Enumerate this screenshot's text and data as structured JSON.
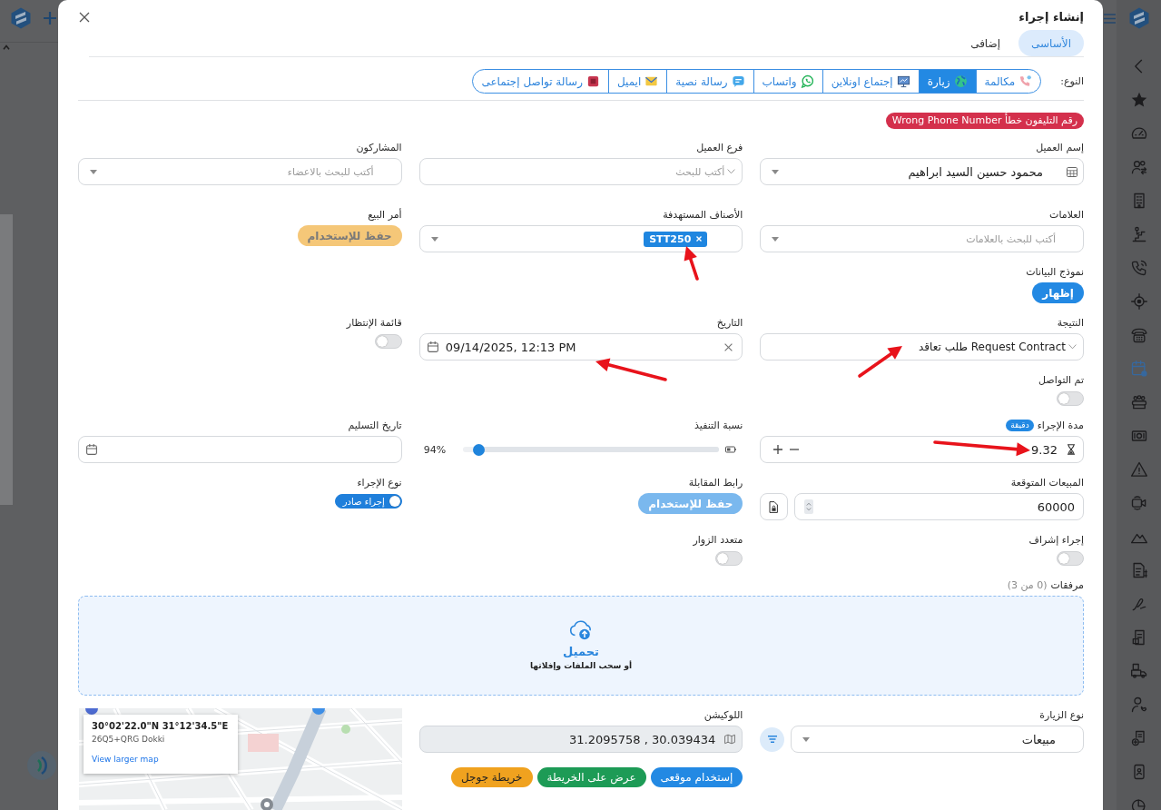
{
  "app_sidebar": {
    "items": [
      {
        "selected": false
      },
      {
        "selected": false
      },
      {
        "selected": false
      },
      {
        "selected": false
      },
      {
        "selected": false
      },
      {
        "selected": false
      },
      {
        "selected": false
      },
      {
        "selected": false
      },
      {
        "selected": true
      },
      {
        "selected": false
      },
      {
        "selected": false
      },
      {
        "selected": false
      },
      {
        "selected": false
      },
      {
        "selected": false
      },
      {
        "selected": false
      },
      {
        "selected": false
      },
      {
        "selected": false
      },
      {
        "selected": false
      },
      {
        "selected": false
      },
      {
        "selected": false
      },
      {
        "selected": false
      },
      {
        "selected": false
      }
    ]
  },
  "dialog": {
    "title": "إنشاء إجراء",
    "tabs": [
      {
        "label": "الأساسى",
        "selected": true
      },
      {
        "label": "إضافى",
        "selected": false
      }
    ],
    "type_selector": {
      "label": "النوع:",
      "options": [
        {
          "label": "مكالمة",
          "selected": false
        },
        {
          "label": "زيارة",
          "selected": true
        },
        {
          "label": "إجتماع اونلاين",
          "selected": false
        },
        {
          "label": "واتساب",
          "selected": false
        },
        {
          "label": "رسالة نصية",
          "selected": false
        },
        {
          "label": "ايميل",
          "selected": false
        },
        {
          "label": "رسالة تواصل إجتماعى",
          "selected": false
        }
      ]
    },
    "alert_badge": "Wrong Phone Number رقم التليفون خطأ",
    "rows": [
      [
        {
          "kind": "lookup",
          "label": "إسم العميل",
          "value": "محمود حسين السيد ابراهيم"
        },
        {
          "kind": "combo",
          "label": "فرع العميل",
          "placeholder": "أكتب للبحث"
        },
        {
          "kind": "select",
          "label": "المشاركون",
          "placeholder": "أكتب للبحث بالاعضاء"
        }
      ],
      [
        {
          "kind": "select",
          "label": "العلامات",
          "placeholder": "أكتب للبحث بالعلامات"
        },
        {
          "kind": "tags",
          "label": "الأصناف المستهدفة",
          "tags": [
            {
              "label": "STT250"
            }
          ],
          "annotation_arrow": true
        },
        {
          "kind": "action",
          "label": "أمر البيع",
          "button": {
            "label": "حفظ للإستخدام",
            "kind": "warning",
            "disabled": true
          }
        }
      ],
      [
        {
          "kind": "action",
          "label": "نموذج البيانات",
          "button": {
            "label": "إظهار",
            "kind": "primary",
            "disabled": false
          }
        }
      ],
      [
        {
          "kind": "combo",
          "label": "النتيجة",
          "value": "Request Contract طلب تعاقد",
          "annotation_arrow": true
        },
        {
          "kind": "date",
          "label": "التاريخ",
          "value": "09/14/2025, 12:13 PM",
          "annotation_arrow": true
        },
        {
          "kind": "toggle",
          "label": "قائمة الإنتظار",
          "on": false
        }
      ],
      [
        {
          "kind": "toggle",
          "label": "تم التواصل",
          "on": false
        }
      ],
      [
        {
          "kind": "duration",
          "label": "مدة الإجراء",
          "unit": "دقيقة",
          "value": "9.32",
          "annotation_arrow": true
        },
        {
          "kind": "slider",
          "label": "نسبة التنفيذ",
          "level": 0.94,
          "reading": "94%"
        },
        {
          "kind": "date",
          "label": "تاريخ التسليم"
        }
      ],
      [
        {
          "kind": "number",
          "label": "المبيعات المتوقعة",
          "value": "60000"
        },
        {
          "kind": "action",
          "label": "رابط المقابلة",
          "button": {
            "label": "حفظ للإستخدام",
            "kind": "primary",
            "disabled": true
          }
        },
        {
          "kind": "toggle",
          "label": "نوع الإجراء",
          "on": true,
          "text": "إجراء صادر"
        }
      ],
      [
        {
          "kind": "toggle",
          "label": "إجراء إشراف",
          "on": false
        },
        {
          "kind": "toggle",
          "label": "متعدد الزوار",
          "on": false
        }
      ]
    ],
    "attachments": {
      "label": "مرفقات",
      "count": "(0 من 3)",
      "upload": "تحميل",
      "hint": "أو سحب الملفات وإفلاتها"
    },
    "bottom_row": [
      {
        "kind": "picker",
        "label": "نوع الزيارة",
        "value": "مبيعات"
      },
      {
        "kind": "location",
        "label": "اللوكيشن",
        "value": "31.2095758 , 30.039434",
        "disabled": true,
        "buttons": [
          {
            "label": "إستخدام موقعى",
            "kind": "primary",
            "disabled": false
          },
          {
            "label": "عرض على الخريطة",
            "kind": "success",
            "disabled": false
          },
          {
            "label": "خريطة جوجل",
            "kind": "warning",
            "disabled": false
          }
        ]
      },
      {
        "kind": "map",
        "coordinates": "30°02'22.0\"N 31°12'34.5\"E",
        "plus_code": "26Q5+QRG Dokki",
        "link": "View larger map"
      }
    ]
  }
}
